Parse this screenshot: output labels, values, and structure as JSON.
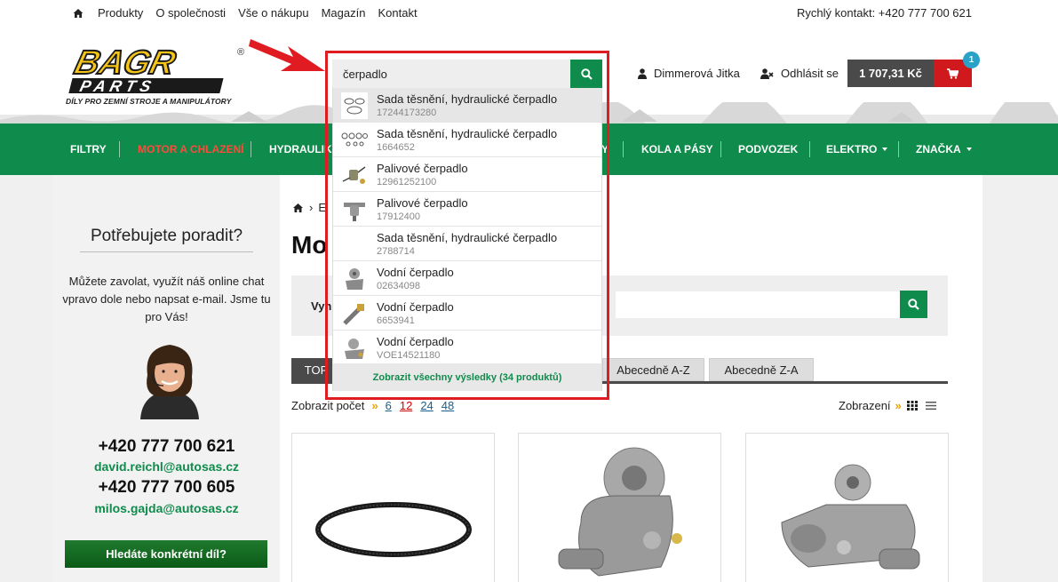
{
  "topnav": {
    "home_icon": "home-icon",
    "links": [
      "Produkty",
      "O společnosti",
      "Vše o nákupu",
      "Magazín",
      "Kontakt"
    ],
    "quick_contact": "Rychlý kontakt: +420 777 700 621"
  },
  "header": {
    "logo_line1": "BAGR",
    "logo_line2": "PARTS",
    "logo_registered": "®",
    "tagline": "DÍLY PRO ZEMNÍ STROJE A MANIPULÁTORY",
    "user_name": "Dimmerová Jitka",
    "logout_label": "Odhlásit se",
    "cart_amount": "1 707,31 Kč",
    "cart_count": "1"
  },
  "mainnav": {
    "items": [
      "FILTRY",
      "MOTOR A CHLAZENÍ",
      "HYDRAULIK",
      "Y",
      "KOLA A PÁSY",
      "PODVOZEK",
      "ELEKTRO",
      "ZNAČKA"
    ]
  },
  "search": {
    "value": "čerpadlo",
    "results": [
      {
        "name": "Sada těsnění, hydraulické čerpadlo",
        "code": "17244173280"
      },
      {
        "name": "Sada těsnění, hydraulické čerpadlo",
        "code": "1664652"
      },
      {
        "name": "Palivové čerpadlo",
        "code": "12961252100"
      },
      {
        "name": "Palivové čerpadlo",
        "code": "17912400"
      },
      {
        "name": "Sada těsnění, hydraulické čerpadlo",
        "code": "2788714"
      },
      {
        "name": "Vodní čerpadlo",
        "code": "02634098"
      },
      {
        "name": "Vodní čerpadlo",
        "code": "6653941"
      },
      {
        "name": "Vodní čerpadlo",
        "code": "VOE14521180"
      }
    ],
    "show_all": "Zobrazit všechny výsledky (34 produktů)"
  },
  "sidebar": {
    "title": "Potřebujete poradit?",
    "text": "Můžete zavolat, využít náš online chat vpravo dole nebo napsat e-mail. Jsme tu pro Vás!",
    "phone1": "+420 777 700 621",
    "email1": "david.reichl@autosas.cz",
    "phone2": "+420 777 700 605",
    "email2": "milos.gajda@autosas.cz",
    "button": "Hledáte konkrétní díl?"
  },
  "content": {
    "breadcrumb_tail": "›",
    "breadcrumb_partial": "E",
    "title_partial": "Mo",
    "filter_label_partial": "Vyh",
    "sort_tabs": [
      "TOP",
      "Abecedně A-Z",
      "Abecedně Z-A"
    ],
    "count_label": "Zobrazit počet",
    "page_sizes": [
      "6",
      "12",
      "24",
      "48"
    ],
    "current_page_size": "12",
    "view_label": "Zobrazení"
  },
  "colors": {
    "brand_green": "#0f8b4c",
    "highlight_red": "#e01b22",
    "cart_red": "#d0191d",
    "logo_yellow": "#f5c518"
  }
}
